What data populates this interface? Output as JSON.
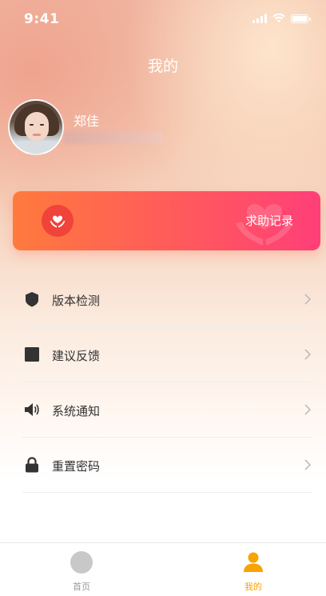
{
  "status_bar": {
    "time": "9:41",
    "icons": [
      "signal-icon",
      "wifi-icon",
      "battery-icon"
    ]
  },
  "header": {
    "title": "我的"
  },
  "profile": {
    "name": "郑佳",
    "avatar_icon": "user-photo"
  },
  "help_card": {
    "label": "求助记录",
    "icon": "heart-hands-icon",
    "colors": {
      "start": "#ff7a3d",
      "end": "#ff3f78",
      "icon_bg": "#f0433a"
    }
  },
  "menu": {
    "items": [
      {
        "label": "版本检测",
        "icon": "shield-icon"
      },
      {
        "label": "建议反馈",
        "icon": "square-icon"
      },
      {
        "label": "系统通知",
        "icon": "speaker-icon"
      },
      {
        "label": "重置密码",
        "icon": "lock-icon"
      }
    ]
  },
  "tab_bar": {
    "tabs": [
      {
        "label": "首页",
        "icon": "home-circle-icon",
        "active": false
      },
      {
        "label": "我的",
        "icon": "person-icon",
        "active": true
      }
    ],
    "colors": {
      "active": "#f7a300",
      "inactive": "#999999"
    }
  }
}
